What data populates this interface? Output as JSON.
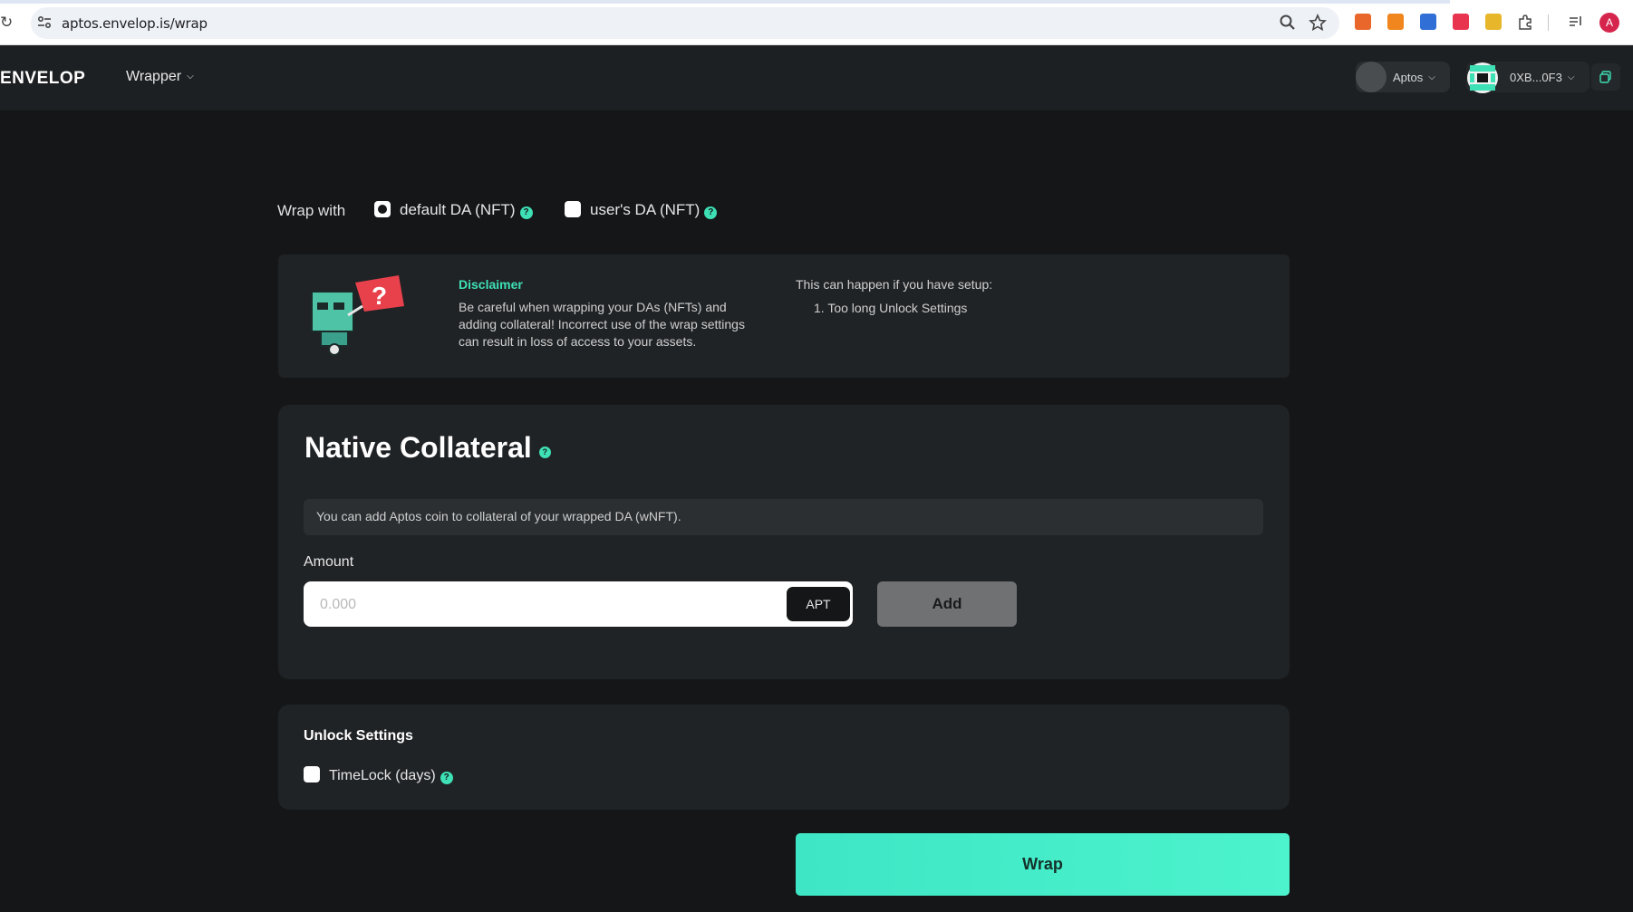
{
  "browser": {
    "url": "aptos.envelop.is/wrap",
    "profile_initial": "A",
    "extensions": [
      {
        "name": "ext-1",
        "color": "#e9672a"
      },
      {
        "name": "metamask",
        "color": "#f0861d"
      },
      {
        "name": "ext-3",
        "color": "#2f6fd6"
      },
      {
        "name": "ext-4",
        "color": "#e9344f"
      },
      {
        "name": "ext-5",
        "color": "#e8b62b"
      }
    ]
  },
  "header": {
    "logo": "ENVELOP",
    "nav_wrapper": "Wrapper",
    "chain": "Aptos",
    "wallet": "0XB...0F3"
  },
  "wrap_with": {
    "label": "Wrap with",
    "option_default": "default DA (NFT)",
    "option_user": "user's DA (NFT)",
    "selected": "default DA (NFT)"
  },
  "disclaimer": {
    "title": "Disclaimer",
    "body": "Be careful when wrapping your DAs (NFTs) and adding collateral! Incorrect use of the wrap settings can result in loss of access to your assets.",
    "right_intro": "This can happen if you have setup:",
    "right_item_1": "1. Too long Unlock Settings"
  },
  "native_collateral": {
    "title": "Native Collateral",
    "info": "You can add Aptos coin to collateral of your wrapped DA (wNFT).",
    "amount_label": "Amount",
    "amount_placeholder": "0.000",
    "currency": "APT",
    "add_label": "Add"
  },
  "unlock_settings": {
    "title": "Unlock Settings",
    "timelock_label": "TimeLock (days)"
  },
  "actions": {
    "wrap_label": "Wrap"
  },
  "colors": {
    "accent": "#3ee0b5",
    "background": "#141617",
    "card": "#202326"
  }
}
